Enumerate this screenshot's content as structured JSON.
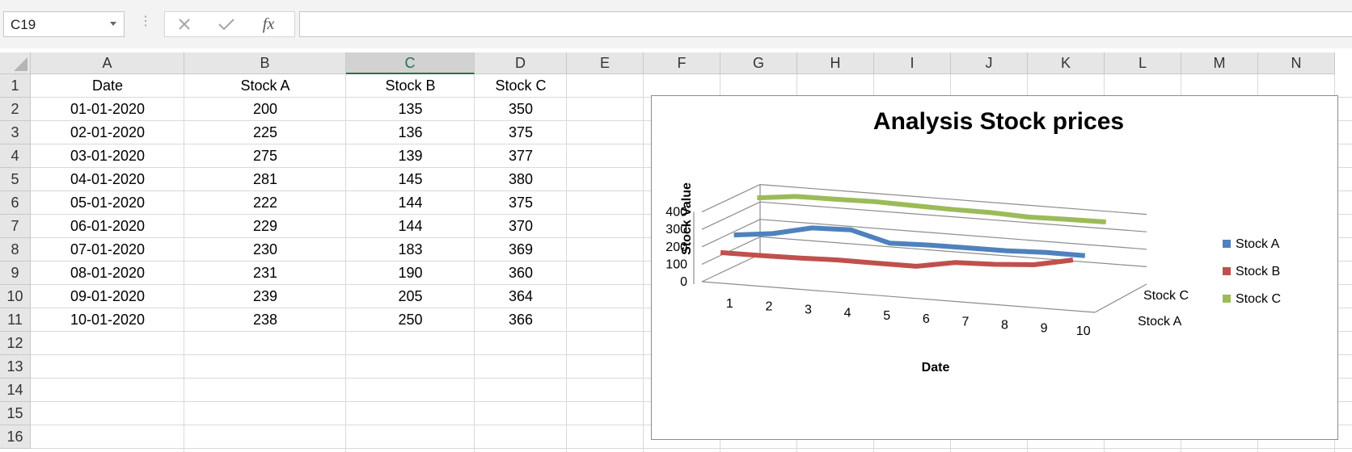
{
  "namebox": {
    "value": "C19"
  },
  "formula_bar": {
    "fx_label": "fx",
    "value": ""
  },
  "columns": [
    "A",
    "B",
    "C",
    "D",
    "E",
    "F",
    "G",
    "H",
    "I",
    "J",
    "K",
    "L",
    "M",
    "N"
  ],
  "selected_column": "C",
  "rows": [
    "1",
    "2",
    "3",
    "4",
    "5",
    "6",
    "7",
    "8",
    "9",
    "10",
    "11",
    "12",
    "13",
    "14",
    "15",
    "16"
  ],
  "table": {
    "headers": [
      "Date",
      "Stock A",
      "Stock B",
      "Stock C"
    ],
    "rows": [
      [
        "01-01-2020",
        "200",
        "135",
        "350"
      ],
      [
        "02-01-2020",
        "225",
        "136",
        "375"
      ],
      [
        "03-01-2020",
        "275",
        "139",
        "377"
      ],
      [
        "04-01-2020",
        "281",
        "145",
        "380"
      ],
      [
        "05-01-2020",
        "222",
        "144",
        "375"
      ],
      [
        "06-01-2020",
        "229",
        "144",
        "370"
      ],
      [
        "07-01-2020",
        "230",
        "183",
        "369"
      ],
      [
        "08-01-2020",
        "231",
        "190",
        "360"
      ],
      [
        "09-01-2020",
        "239",
        "205",
        "364"
      ],
      [
        "10-01-2020",
        "238",
        "250",
        "366"
      ]
    ]
  },
  "chart_data": {
    "type": "line",
    "title": "Analysis Stock prices",
    "xlabel": "Date",
    "ylabel": "Stock Value",
    "x": [
      "1",
      "2",
      "3",
      "4",
      "5",
      "6",
      "7",
      "8",
      "9",
      "10"
    ],
    "yticks": [
      "0",
      "100",
      "200",
      "300",
      "400"
    ],
    "ylim": [
      0,
      400
    ],
    "depth_labels": [
      "Stock A",
      "Stock C"
    ],
    "legend_position": "right",
    "grid": true,
    "series": [
      {
        "name": "Stock A",
        "color": "#4f81bd",
        "values": [
          200,
          225,
          275,
          281,
          222,
          229,
          230,
          231,
          239,
          238
        ]
      },
      {
        "name": "Stock B",
        "color": "#c0504d",
        "values": [
          135,
          136,
          139,
          145,
          144,
          144,
          183,
          190,
          205,
          250
        ]
      },
      {
        "name": "Stock C",
        "color": "#9bbb59",
        "values": [
          350,
          375,
          377,
          380,
          375,
          370,
          369,
          360,
          364,
          366
        ]
      }
    ]
  }
}
